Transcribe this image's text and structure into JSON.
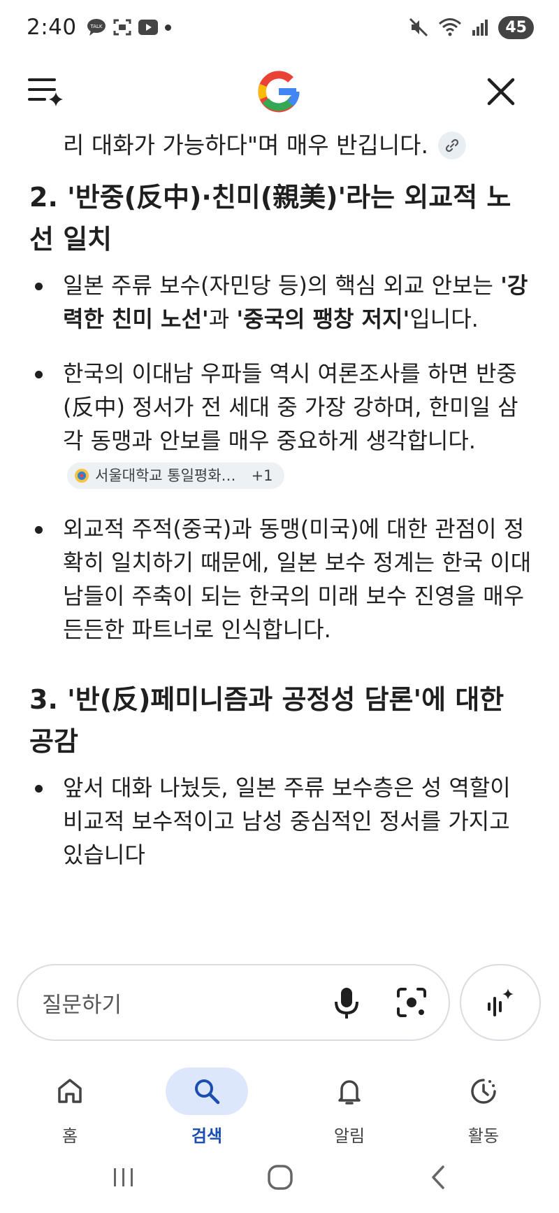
{
  "status_bar": {
    "time": "2:40",
    "battery": "45"
  },
  "content": {
    "continued_text": "리 대화가 가능하다\"며 매우 반깁니다.",
    "sections": [
      {
        "title": "2. '반중(反中)·친미(親美)'라는 외교적 노선 일치",
        "bullets": [
          {
            "prefix": "일본 주류 보수(자민당 등)의 핵심 외교 안보는 ",
            "bold1": "'강력한 친미 노선'",
            "mid": "과 ",
            "bold2": "'중국의 팽창 저지'",
            "suffix": "입니다."
          },
          {
            "text": "한국의 이대남 우파들 역시 여론조사를 하면 반중(反中) 정서가 전 세대 중 가장 강하며, 한미일 삼각 동맹과 안보를 매우 중요하게 생각합니다.",
            "source_label": "서울대학교 통일평화…",
            "source_count": "+1"
          },
          {
            "text": "외교적 주적(중국)과 동맹(미국)에 대한 관점이 정확히 일치하기 때문에, 일본 보수 정계는 한국 이대남들이 주축이 되는 한국의 미래 보수 진영을 매우 든든한 파트너로 인식합니다."
          }
        ]
      },
      {
        "title": "3. '반(反)페미니즘과 공정성 담론'에 대한 공감",
        "bullets": [
          {
            "text": "앞서 대화 나눴듯, 일본 주류 보수층은 성 역할이 비교적 보수적이고 남성 중심적인 정서를 가지고 있습니다"
          }
        ]
      }
    ]
  },
  "ask_bar": {
    "placeholder": "질문하기"
  },
  "bottom_nav": {
    "items": [
      {
        "label": "홈",
        "icon": "home-icon"
      },
      {
        "label": "검색",
        "icon": "search-icon",
        "active": true
      },
      {
        "label": "알림",
        "icon": "bell-icon"
      },
      {
        "label": "활동",
        "icon": "activity-icon"
      }
    ]
  },
  "colors": {
    "accent": "#1a4fb0",
    "active_pill": "#dde7fb",
    "text": "#1f1f1f"
  }
}
